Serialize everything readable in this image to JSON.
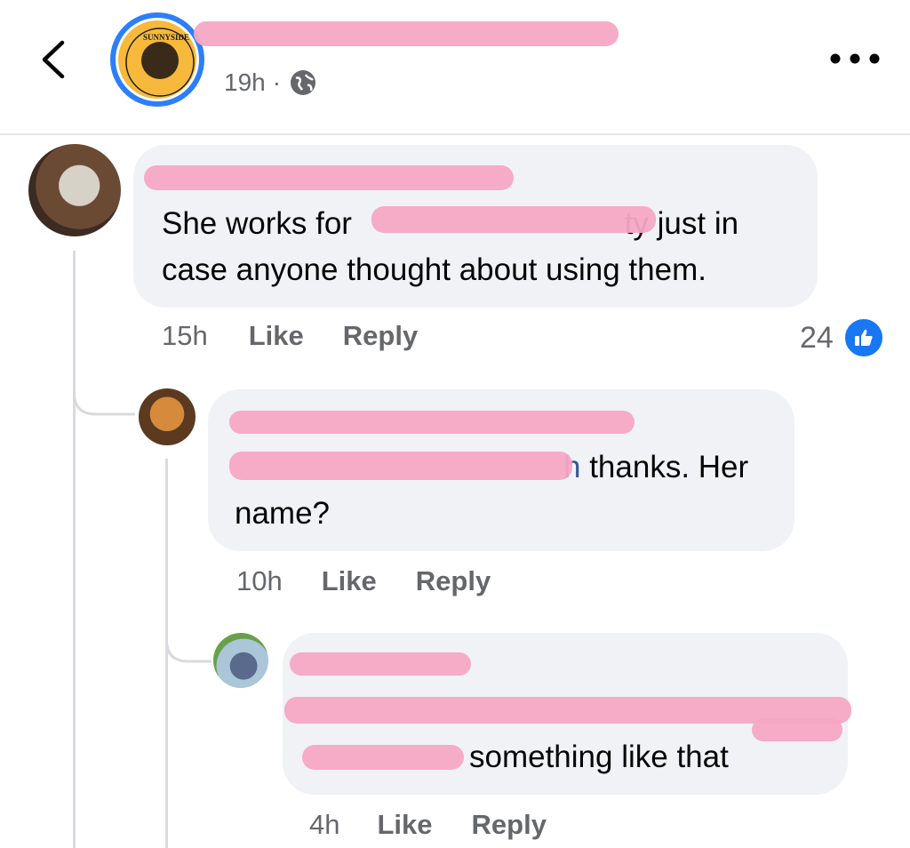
{
  "header": {
    "back_label": "<",
    "page_name": "",
    "timestamp": "19h",
    "separator": "·",
    "audience_icon": "globe-icon",
    "more_label": "•••",
    "avatar_logo": "SUNNYSIDE"
  },
  "comments": [
    {
      "author": "",
      "text_line1_before": "She works for ",
      "text_line1_after": "ty just in",
      "text_line2": "case anyone thought about using them.",
      "time": "15h",
      "like_label": "Like",
      "reply_label": "Reply",
      "reaction_count": "24",
      "reaction_icon": "thumbs-up-icon"
    },
    {
      "author": "",
      "mention_tail": "h",
      "text_line1_after": " thanks. Her",
      "text_line2": "name?",
      "time": "10h",
      "like_label": "Like",
      "reply_label": "Reply"
    },
    {
      "author": "",
      "text_line3_after": "something like that",
      "time": "4h",
      "like_label": "Like",
      "reply_label": "Reply"
    }
  ],
  "colors": {
    "accent_blue": "#1877f2",
    "bubble_bg": "#f0f2f5",
    "muted_text": "#65676b",
    "redaction_pink": "#f6a6c4"
  }
}
